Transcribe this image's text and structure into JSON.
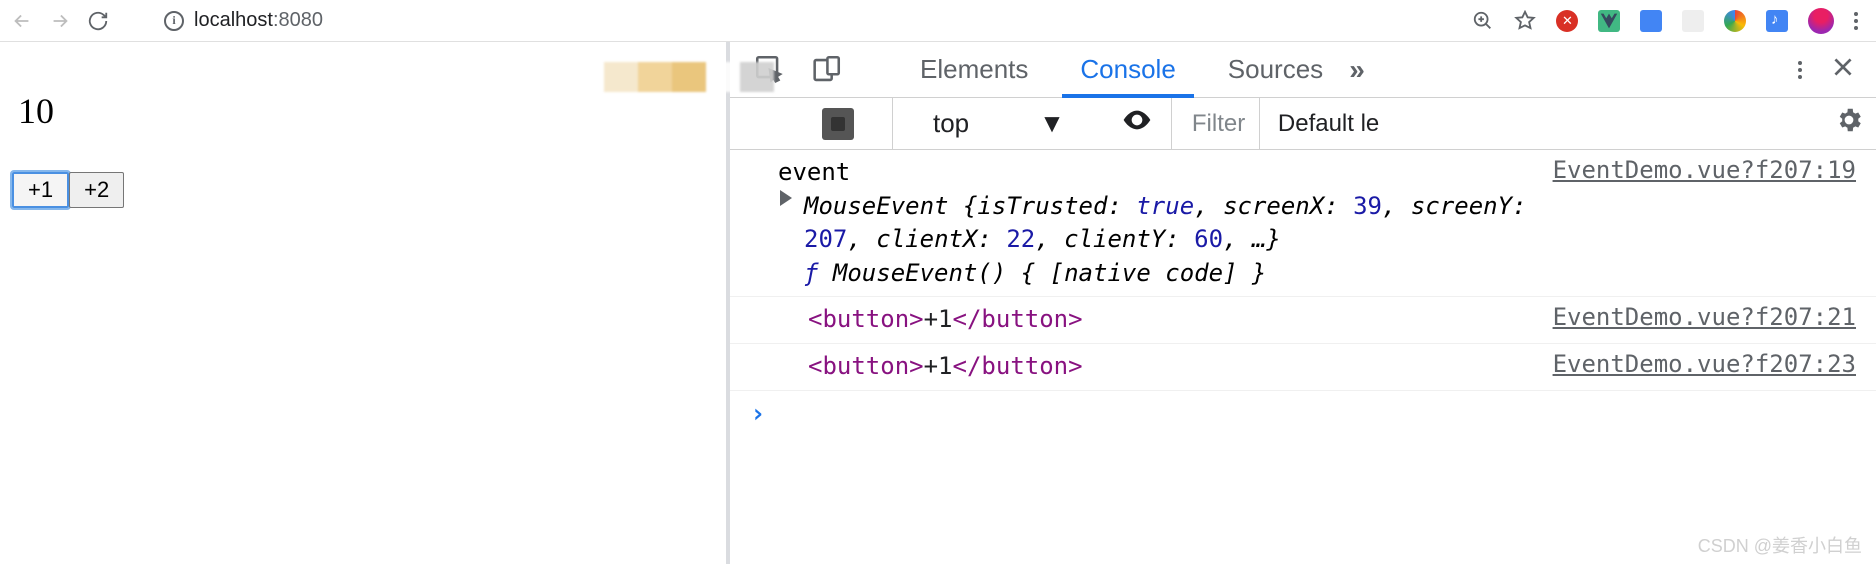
{
  "browser": {
    "url_host": "localhost",
    "url_port": ":8080"
  },
  "page": {
    "counter": "10",
    "btn1": "+1",
    "btn2": "+2"
  },
  "devtools": {
    "tabs": {
      "elements": "Elements",
      "console": "Console",
      "sources": "Sources"
    },
    "toolbar": {
      "context": "top",
      "filter_placeholder": "Filter",
      "levels": "Default le"
    },
    "logs": [
      {
        "label": "event",
        "source": "EventDemo.vue?f207:19",
        "obj_type": "MouseEvent",
        "props": {
          "isTrusted_k": "isTrusted:",
          "isTrusted_v": "true",
          "screenX_k": "screenX:",
          "screenX_v": "39",
          "screenY_k": "screenY:",
          "screenY_v": "207",
          "clientX_k": "clientX:",
          "clientX_v": "22",
          "clientY_k": "clientY:",
          "clientY_v": "60"
        },
        "fn_line": "MouseEvent() { [native code] }"
      },
      {
        "html_tag": "button",
        "html_text": "+1",
        "source": "EventDemo.vue?f207:21"
      },
      {
        "html_tag": "button",
        "html_text": "+1",
        "source": "EventDemo.vue?f207:23"
      }
    ]
  },
  "watermark": "CSDN @姜香小白鱼"
}
